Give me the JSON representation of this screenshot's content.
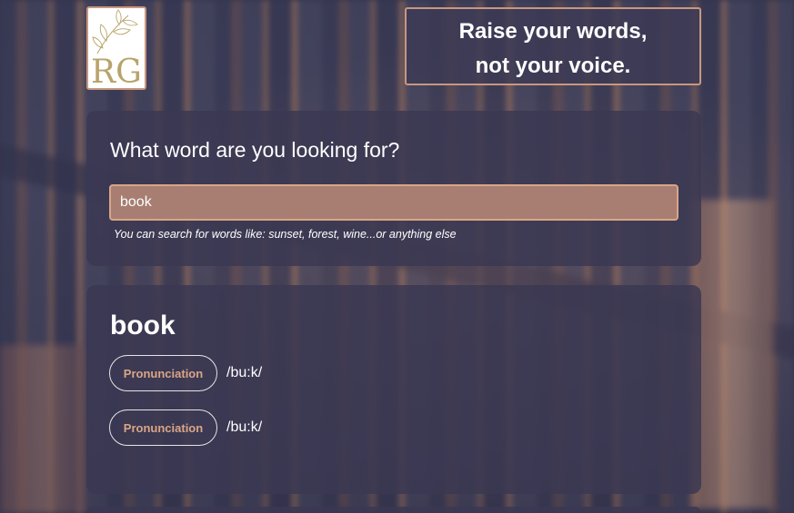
{
  "header": {
    "logo_letters": "RG",
    "slogan_line1": "Raise your words,",
    "slogan_line2": "not your voice."
  },
  "search": {
    "heading": "What word are you looking for?",
    "input_value": "book",
    "hint": "You can search for words like: sunset, forest, wine...or anything else"
  },
  "result": {
    "word": "book",
    "pronunciations": [
      {
        "button_label": "Pronunciation",
        "phonetic": "/bu:k/"
      },
      {
        "button_label": "Pronunciation",
        "phonetic": "/bu:k/"
      }
    ]
  },
  "colors": {
    "accent": "#d9a587",
    "border": "#c8977f",
    "card": "#3a3852",
    "input_bg": "#a77e71"
  }
}
